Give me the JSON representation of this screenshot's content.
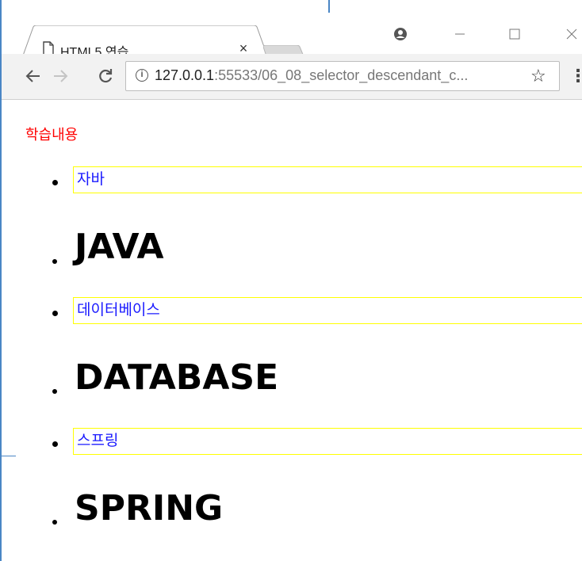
{
  "browser": {
    "tab_title": "HTML5 연습",
    "tab_close": "×",
    "url_host": "127.0.0.1",
    "url_rest": ":55533/06_08_selector_descendant_c...",
    "window_controls": {
      "profile": "profile-icon",
      "minimize": "minimize-icon",
      "maximize": "maximize-icon",
      "close": "close-icon"
    }
  },
  "page": {
    "heading": "학습내용",
    "items": [
      {
        "label": "자바",
        "title": "JAVA"
      },
      {
        "label": "데이터베이스",
        "title": "DATABASE"
      },
      {
        "label": "스프링",
        "title": "SPRING"
      }
    ]
  },
  "colors": {
    "heading": "#ff0000",
    "item_text": "#1a1aff",
    "item_border": "#ffff00",
    "window_border": "#4a86c5"
  }
}
